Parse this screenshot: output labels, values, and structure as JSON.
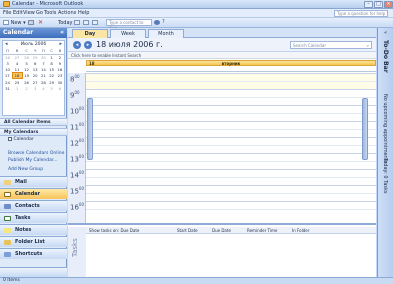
{
  "window": {
    "title": "Calendar - Microsoft Outlook"
  },
  "menu": {
    "items": [
      "File",
      "Edit",
      "View",
      "Go",
      "Tools",
      "Actions",
      "Help"
    ],
    "help_placeholder": "Type a question for help"
  },
  "toolbar": {
    "new_label": "New",
    "today_label": "Today",
    "contact_placeholder": "Type a contact to find"
  },
  "nav": {
    "header": "Calendar",
    "minical": {
      "month_label": "Июль 2006",
      "dows": [
        "П",
        "В",
        "С",
        "Ч",
        "П",
        "С",
        "В"
      ],
      "weeks": [
        [
          "26",
          "27",
          "28",
          "29",
          "30",
          "1",
          "2"
        ],
        [
          "3",
          "4",
          "5",
          "6",
          "7",
          "8",
          "9"
        ],
        [
          "10",
          "11",
          "12",
          "13",
          "14",
          "15",
          "16"
        ],
        [
          "17",
          "18",
          "19",
          "20",
          "21",
          "22",
          "23"
        ],
        [
          "24",
          "25",
          "26",
          "27",
          "28",
          "29",
          "30"
        ],
        [
          "31",
          "1",
          "2",
          "3",
          "4",
          "5",
          "6"
        ]
      ],
      "selected": "18"
    },
    "all_calendar_items": "All Calendar Items",
    "my_calendars": "My Calendars",
    "calendar_item": "Calendar",
    "links": [
      "Browse Calendars Online",
      "Publish My Calendar...",
      "Add New Group"
    ],
    "buttons": [
      "Mail",
      "Calendar",
      "Contacts",
      "Tasks",
      "Notes",
      "Folder List",
      "Shortcuts"
    ]
  },
  "main": {
    "tabs": [
      "Day",
      "Week",
      "Month"
    ],
    "active_tab": "Day",
    "date_title": "18 июля 2006 г.",
    "search_placeholder": "Search Calendar",
    "info_bar": "Click here to enable Instant Search",
    "day_number": "18",
    "day_name": "вторник",
    "hours": [
      "8",
      "9",
      "10",
      "11",
      "12",
      "13",
      "14",
      "15",
      "16"
    ],
    "hour_suffix": "00",
    "tasks_label": "Tasks",
    "task_columns": [
      "Show tasks on: Due Date",
      "Start Date",
      "Due Date",
      "Reminder Time",
      "In Folder"
    ]
  },
  "todo_bar": {
    "title": "To-Do Bar",
    "appointments": "No upcoming appointments.",
    "tasks": "Today: 0 Tasks"
  },
  "status": {
    "items": "0 Items"
  },
  "colors": {
    "accent": "#f7c359",
    "brand": "#3e6fbd"
  }
}
